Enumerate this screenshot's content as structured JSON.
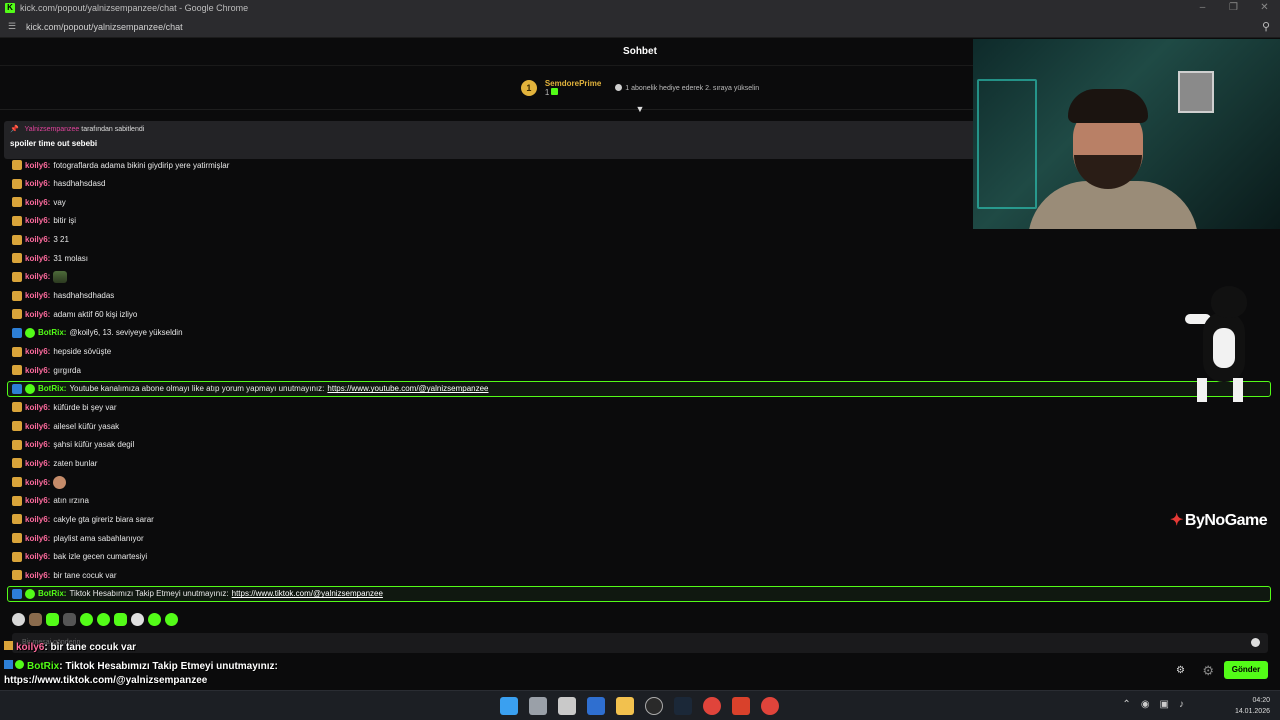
{
  "window": {
    "title": "kick.com/popout/yalnizsempanzee/chat - Google Chrome",
    "url": "kick.com/popout/yalnizsempanzee/chat"
  },
  "chat": {
    "header": "Sohbet",
    "leaderboard": {
      "rank": "1",
      "name": "SemdorePrime",
      "count": "1",
      "hint": "1 abonelik hediye ederek 2. sıraya yükselin"
    },
    "pinned": {
      "author": "Yalnizsempanzee",
      "suffix": "tarafından sabitlendi",
      "text": "spoiler time out sebebi"
    },
    "messages": [
      {
        "user": "koily6",
        "text": "fotograflarda adama bikini giydirip yere yatirmişlar",
        "type": "user"
      },
      {
        "user": "koily6",
        "text": "hasdhahsdasd",
        "type": "user"
      },
      {
        "user": "koily6",
        "text": "vay",
        "type": "user"
      },
      {
        "user": "koily6",
        "text": "bitir işi",
        "type": "user"
      },
      {
        "user": "koily6",
        "text": "3 21",
        "type": "user"
      },
      {
        "user": "koily6",
        "text": "31 molası",
        "type": "user"
      },
      {
        "user": "koily6",
        "text": "",
        "type": "emote-tank"
      },
      {
        "user": "koily6",
        "text": "hasdhahsdhadas",
        "type": "user"
      },
      {
        "user": "koily6",
        "text": "adamı aktif 60 kişi izliyo",
        "type": "user"
      },
      {
        "user": "BotRix",
        "text": "@koily6, 13. seviyeye yükseldin",
        "type": "bot"
      },
      {
        "user": "koily6",
        "text": "hepside sövüşte",
        "type": "user"
      },
      {
        "user": "koily6",
        "text": "gırgırda",
        "type": "user"
      },
      {
        "user": "BotRix",
        "text": "Youtube kanalımıza abone olmayı like atıp yorum yapmayı unutmayınız:",
        "link": "https://www.youtube.com/@yalnizsempanzee",
        "type": "bot-highlight"
      },
      {
        "user": "koily6",
        "text": "küfürde bi şey var",
        "type": "user"
      },
      {
        "user": "koily6",
        "text": "ailesel küfür yasak",
        "type": "user"
      },
      {
        "user": "koily6",
        "text": "şahsi küfür yasak degil",
        "type": "user"
      },
      {
        "user": "koily6",
        "text": "zaten bunlar",
        "type": "user"
      },
      {
        "user": "koily6",
        "text": "",
        "type": "emote-face"
      },
      {
        "user": "koily6",
        "text": "atın ırzına",
        "type": "user"
      },
      {
        "user": "koily6",
        "text": "cakyle gta gireriz biara sarar",
        "type": "user"
      },
      {
        "user": "koily6",
        "text": "playlist ama sabahlanıyor",
        "type": "user"
      },
      {
        "user": "koily6",
        "text": "bak izle gecen cumartesiyi",
        "type": "user"
      },
      {
        "user": "koily6",
        "text": "bir tane cocuk var",
        "type": "user"
      },
      {
        "user": "BotRix",
        "text": "Tiktok Hesabımızı Takip Etmeyi unutmayınız:",
        "link": "https://www.tiktok.com/@yalnizsempanzee",
        "type": "bot-highlight"
      }
    ],
    "input_placeholder": "Bir mesaj gönderin",
    "send_label": "Gönder"
  },
  "overlay": {
    "line1_user": "koily6",
    "line1_text": ": bir tane cocuk var",
    "line2_user": "BotRix",
    "line2_text": ": Tiktok Hesabımızı Takip Etmeyi unutmayınız:",
    "line3_text": "https://www.tiktok.com/@yalnizsempanzee",
    "brand": "ByNoGame"
  },
  "taskbar": {
    "time": "04:20",
    "date": "14.01.2026"
  },
  "colors": {
    "accent": "#53fc18",
    "username": "#ff6b9e",
    "gold": "#e2b33c"
  }
}
